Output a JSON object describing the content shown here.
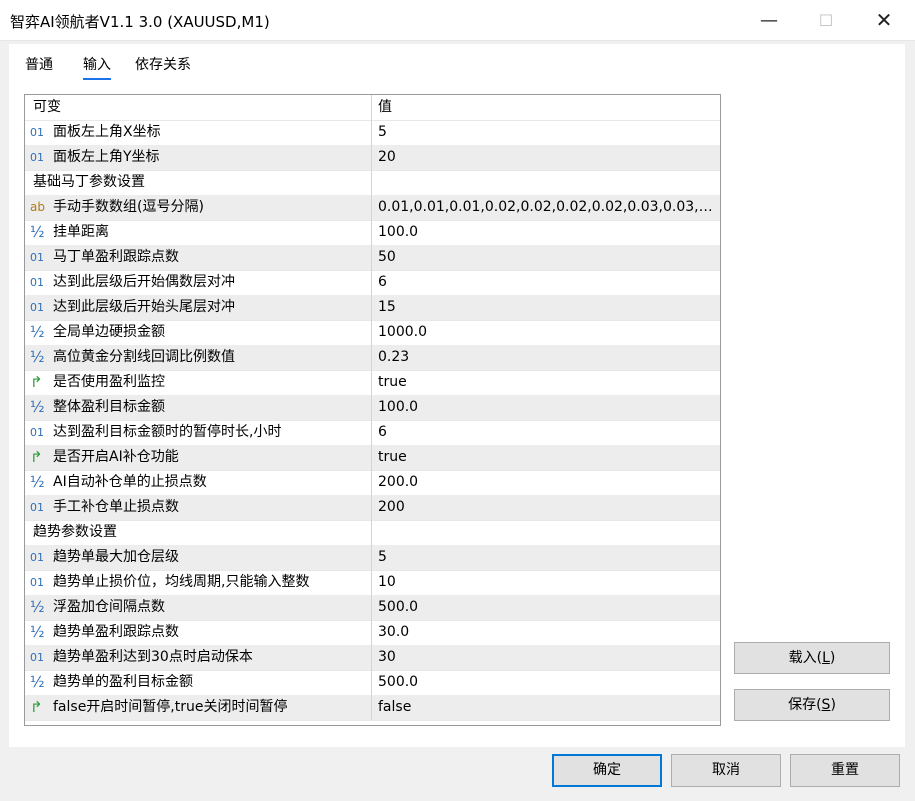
{
  "window": {
    "title": "智弈AI领航者V1.1 3.0 (XAUUSD,M1)",
    "min_icon": "—",
    "max_icon": "☐",
    "close_icon": "✕"
  },
  "tabs": [
    {
      "label": "普通",
      "active": false
    },
    {
      "label": "输入",
      "active": true
    },
    {
      "label": "依存关系",
      "active": false
    }
  ],
  "grid": {
    "header": {
      "name": "可变",
      "value": "值"
    },
    "icon_glyphs": {
      "int": "01",
      "str": "ab",
      "double": "½",
      "bool": "↱"
    },
    "rows": [
      {
        "icon": "int",
        "name": "面板左上角X坐标",
        "value": "5"
      },
      {
        "icon": "int",
        "name": "面板左上角Y坐标",
        "value": "20"
      },
      {
        "icon": "none",
        "name": "基础马丁参数设置",
        "value": ""
      },
      {
        "icon": "str",
        "name": "手动手数数组(逗号分隔)",
        "value": "0.01,0.01,0.01,0.02,0.02,0.02,0.02,0.03,0.03,0..."
      },
      {
        "icon": "double",
        "name": "挂单距离",
        "value": "100.0"
      },
      {
        "icon": "int",
        "name": "马丁单盈利跟踪点数",
        "value": "50"
      },
      {
        "icon": "int",
        "name": "达到此层级后开始偶数层对冲",
        "value": "6"
      },
      {
        "icon": "int",
        "name": "达到此层级后开始头尾层对冲",
        "value": "15"
      },
      {
        "icon": "double",
        "name": "全局单边硬损金额",
        "value": "1000.0"
      },
      {
        "icon": "double",
        "name": "高位黄金分割线回调比例数值",
        "value": "0.23"
      },
      {
        "icon": "bool",
        "name": "是否使用盈利监控",
        "value": "true"
      },
      {
        "icon": "double",
        "name": "整体盈利目标金额",
        "value": "100.0"
      },
      {
        "icon": "int",
        "name": "达到盈利目标金额时的暂停时长,小时",
        "value": "6"
      },
      {
        "icon": "bool",
        "name": "是否开启AI补仓功能",
        "value": "true"
      },
      {
        "icon": "double",
        "name": "AI自动补仓单的止损点数",
        "value": "200.0"
      },
      {
        "icon": "int",
        "name": "手工补仓单止损点数",
        "value": "200"
      },
      {
        "icon": "none",
        "name": "趋势参数设置",
        "value": ""
      },
      {
        "icon": "int",
        "name": "趋势单最大加仓层级",
        "value": "5"
      },
      {
        "icon": "int",
        "name": "趋势单止损价位，均线周期,只能输入整数",
        "value": "10"
      },
      {
        "icon": "double",
        "name": "浮盈加仓间隔点数",
        "value": "500.0"
      },
      {
        "icon": "double",
        "name": "趋势单盈利跟踪点数",
        "value": "30.0"
      },
      {
        "icon": "int",
        "name": "趋势单盈利达到30点时启动保本",
        "value": "30"
      },
      {
        "icon": "double",
        "name": "趋势单的盈利目标金额",
        "value": "500.0"
      },
      {
        "icon": "bool",
        "name": "false开启时间暂停,true关闭时间暂停",
        "value": "false"
      }
    ]
  },
  "side_buttons": {
    "load_label": "载入(",
    "load_key": "L",
    "load_tail": ")",
    "save_label": "保存(",
    "save_key": "S",
    "save_tail": ")"
  },
  "bottom_buttons": {
    "ok": "确定",
    "cancel": "取消",
    "reset": "重置"
  },
  "colors": {
    "accent": "#1a73e8",
    "ok_border": "#0078d7",
    "row_alt": "#ededed"
  }
}
